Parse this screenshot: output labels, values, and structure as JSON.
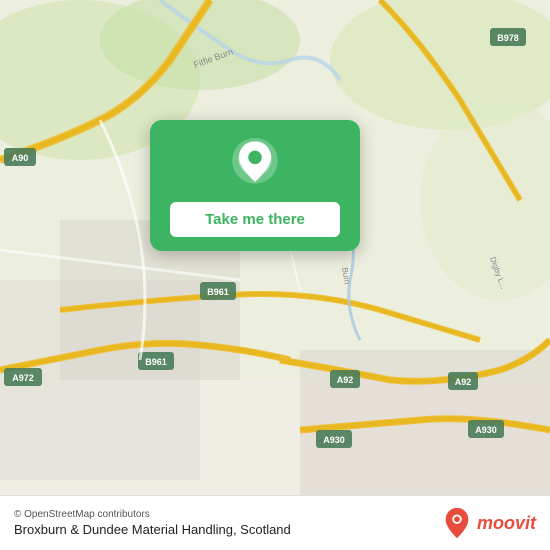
{
  "map": {
    "attribution": "© OpenStreetMap contributors",
    "background_color": "#f0ede5"
  },
  "card": {
    "button_label": "Take me there",
    "pin_icon": "location-pin"
  },
  "bottom_bar": {
    "attribution": "© OpenStreetMap contributors",
    "location_name": "Broxburn & Dundee Material Handling, Scotland",
    "moovit_text": "moovit"
  },
  "roads": {
    "a90_label": "A90",
    "b978_label": "B978",
    "b961_label": "B961",
    "a972_label": "A972",
    "a92_label": "A92",
    "a930_label": "A930"
  }
}
